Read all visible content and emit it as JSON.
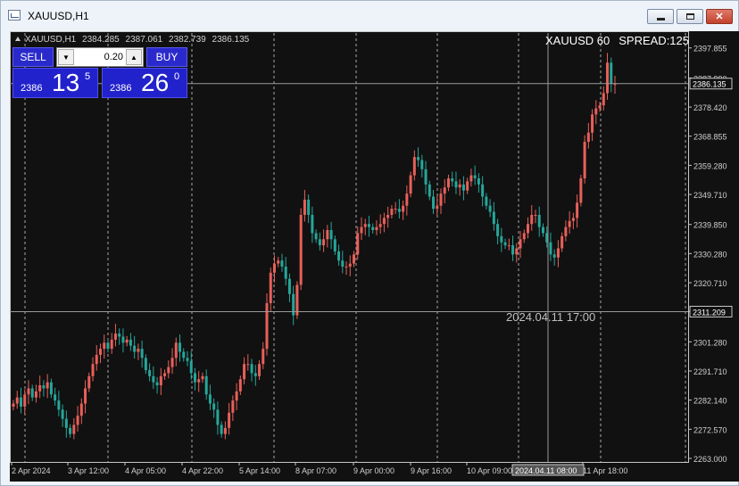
{
  "window": {
    "title": "XAUUSD,H1"
  },
  "chart_header": {
    "symbol_tf": "XAUUSD,H1",
    "open": "2384.285",
    "high": "2387.061",
    "low": "2382.739",
    "close": "2386.135",
    "symbol_period": "XAUUSD 60",
    "spread": "SPREAD:125"
  },
  "trade_panel": {
    "sell_label": "SELL",
    "buy_label": "BUY",
    "lot": "0.20",
    "sell_prefix": "2386",
    "sell_big": "13",
    "sell_sup": "5",
    "buy_prefix": "2386",
    "buy_big": "26",
    "buy_sup": "0"
  },
  "crosshair": {
    "time_text": "2024.04.11 17:00",
    "price_label": "2311.209",
    "time_label": "2024.04.11 08:00"
  },
  "colors": {
    "background": "#111111",
    "bull": "#e8605a",
    "bear": "#26a69a",
    "grid": "#d8d8d8",
    "axis_text": "#d0d0d0"
  },
  "chart_data": {
    "type": "candlestick",
    "symbol": "XAUUSD",
    "timeframe": "H1",
    "price_axis": [
      "2397.855",
      "2387.990",
      "2378.420",
      "2368.855",
      "2359.280",
      "2349.710",
      "2339.850",
      "2330.280",
      "2320.710",
      "2311.209",
      "2301.280",
      "2291.710",
      "2282.140",
      "2272.570",
      "2263.000"
    ],
    "current_price": "2386.135",
    "time_axis": [
      "2 Apr 2024",
      "3 Apr 12:00",
      "4 Apr 05:00",
      "4 Apr 22:00",
      "5 Apr 14:00",
      "8 Apr 07:00",
      "9 Apr 00:00",
      "9 Apr 16:00",
      "10 Apr 09:00",
      "11 Apr 18:00"
    ],
    "ylim": [
      2263.0,
      2401.0
    ],
    "closes": [
      2281,
      2283,
      2280,
      2284,
      2286,
      2283,
      2285,
      2287,
      2286,
      2288,
      2284,
      2282,
      2279,
      2276,
      2273,
      2271,
      2274,
      2277,
      2281,
      2286,
      2290,
      2294,
      2297,
      2299,
      2301,
      2299,
      2302,
      2304,
      2303,
      2301,
      2302,
      2300,
      2298,
      2299,
      2296,
      2292,
      2290,
      2288,
      2287,
      2290,
      2291,
      2293,
      2296,
      2301,
      2298,
      2296,
      2295,
      2291,
      2288,
      2289,
      2290,
      2284,
      2281,
      2279,
      2274,
      2271,
      2273,
      2278,
      2282,
      2285,
      2289,
      2294,
      2294,
      2291,
      2290,
      2294,
      2299,
      2314,
      2324,
      2327,
      2328,
      2326,
      2322,
      2317,
      2310,
      2320,
      2343,
      2348,
      2343,
      2337,
      2335,
      2333,
      2335,
      2338,
      2335,
      2331,
      2328,
      2326,
      2326,
      2327,
      2330,
      2337,
      2339,
      2340,
      2339,
      2338,
      2339,
      2340,
      2342,
      2343,
      2345,
      2345,
      2344,
      2346,
      2350,
      2356,
      2362,
      2361,
      2358,
      2353,
      2349,
      2345,
      2346,
      2350,
      2352,
      2355,
      2354,
      2352,
      2353,
      2351,
      2354,
      2356,
      2355,
      2353,
      2349,
      2346,
      2344,
      2340,
      2336,
      2334,
      2333,
      2333,
      2330,
      2332,
      2335,
      2337,
      2340,
      2343,
      2343,
      2339,
      2337,
      2334,
      2330,
      2329,
      2332,
      2336,
      2339,
      2341,
      2342,
      2347,
      2355,
      2367,
      2370,
      2376,
      2378,
      2379,
      2383,
      2393,
      2386,
      2386
    ]
  }
}
